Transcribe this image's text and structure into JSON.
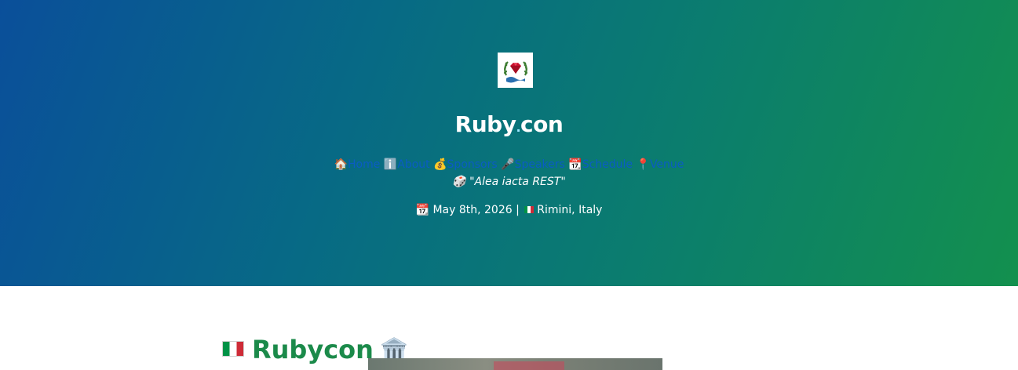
{
  "site": {
    "title_main": "Ruby",
    "title_dot": ".",
    "title_suffix": "con",
    "logo_name": "ruby-laurel-logo"
  },
  "nav": {
    "items": [
      {
        "emoji": "🏠",
        "label": "Home"
      },
      {
        "emoji": "ℹ️",
        "label": "About"
      },
      {
        "emoji": "💰",
        "label": "Sponsors"
      },
      {
        "emoji": "🎤",
        "label": "Speakers"
      },
      {
        "emoji": "📆",
        "label": "Schedule"
      },
      {
        "emoji": "📍",
        "label": "Venue"
      }
    ]
  },
  "tagline": {
    "emoji": "🎲",
    "text": "\"Alea iacta REST\""
  },
  "event": {
    "date_emoji": "📆",
    "date": "May 8th, 2026",
    "separator": "|",
    "location": "Rimini, Italy"
  },
  "content": {
    "heading": "Rubycon",
    "heading_emoji": "🏛️"
  },
  "colors": {
    "hero_start": "#0a4f9a",
    "hero_end": "#13904e",
    "link": "#0a5cc4",
    "heading_green": "#1b8a4a",
    "ruby_red": "#c8102e"
  }
}
